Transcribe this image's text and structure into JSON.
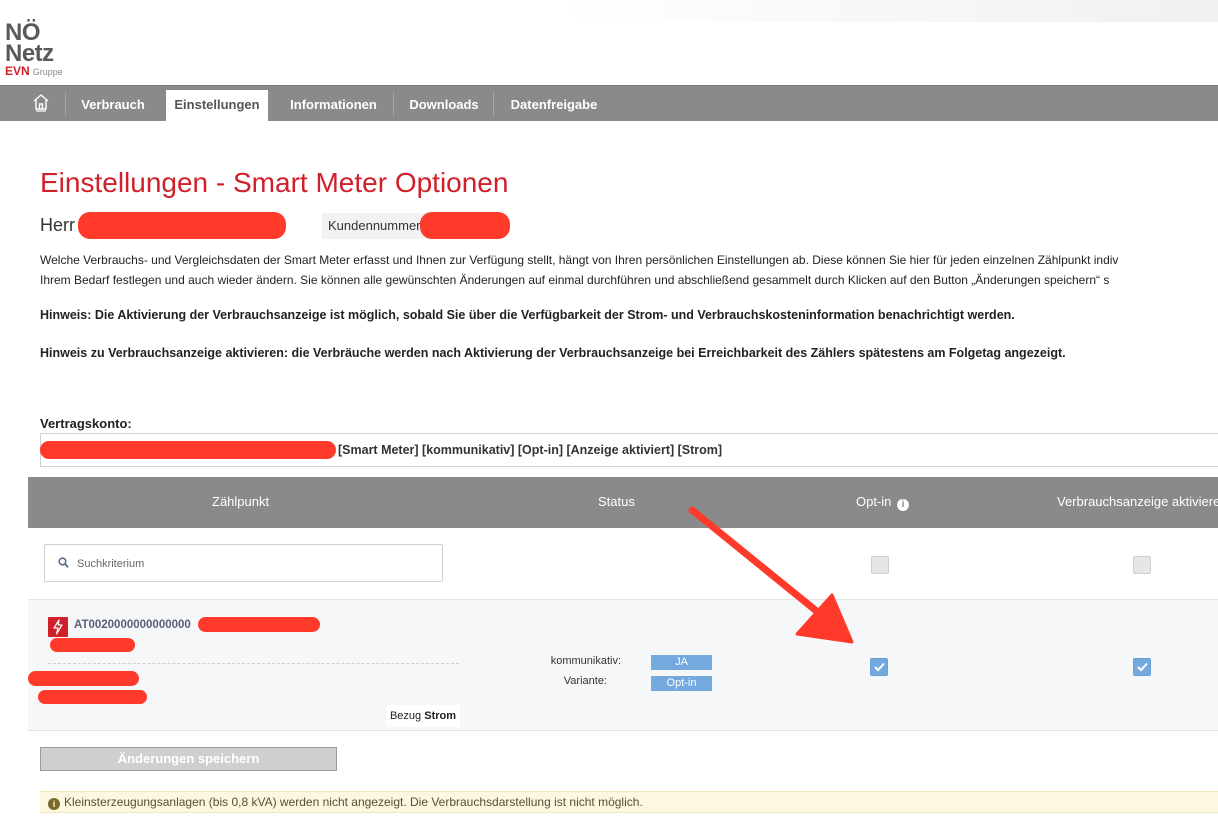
{
  "logo": {
    "line1": "NÖ",
    "line2": "Netz",
    "brand": "EVN",
    "group": "Gruppe"
  },
  "nav": {
    "home_icon": "home-icon",
    "items": [
      {
        "label": "Verbrauch"
      },
      {
        "label": "Einstellungen",
        "active": true
      },
      {
        "label": "Informationen"
      },
      {
        "label": "Downloads"
      },
      {
        "label": "Datenfreigabe"
      }
    ]
  },
  "page": {
    "title": "Einstellungen - Smart Meter Optionen",
    "salutation": "Herr",
    "customer_number_label": "Kundennummer",
    "description_line1": "Welche Verbrauchs- und Vergleichsdaten der Smart Meter erfasst und Ihnen zur Verfügung stellt, hängt von Ihren persönlichen Einstellungen ab. Diese können Sie hier für jeden einzelnen Zählpunkt indiv",
    "description_line2": "Ihrem Bedarf festlegen und auch wieder ändern. Sie können alle gewünschten Änderungen auf einmal durchführen und abschließend gesammelt durch Klicken auf den Button „Änderungen speichern“ s",
    "hint1": "Hinweis: Die Aktivierung der Verbrauchsanzeige ist möglich, sobald Sie über die Verfügbarkeit der Strom- und Verbrauchskosteninformation benachrichtigt werden.",
    "hint2": "Hinweis zu Verbrauchsanzeige aktivieren: die Verbräuche werden nach Aktivierung der Verbrauchsanzeige bei Erreichbarkeit des Zählers spätestens am Folgetag angezeigt."
  },
  "contract": {
    "label": "Vertragskonto:",
    "value": "[Smart Meter] [kommunikativ] [Opt-in] [Anzeige aktiviert] [Strom]"
  },
  "table": {
    "headers": {
      "zaehlpunkt": "Zählpunkt",
      "status": "Status",
      "optin": "Opt-in",
      "verbrauchsanzeige": "Verbrauchsanzeige aktiviere"
    },
    "search": {
      "placeholder": "Suchkriterium",
      "value": ""
    },
    "select_all": {
      "optin_checked": false,
      "verbrauchsanzeige_checked": false
    },
    "rows": [
      {
        "zaehlpunkt_id": "AT0020000000000000",
        "status_labels": {
          "kommunikativ": "kommunikativ:",
          "variante": "Variante:"
        },
        "status_values": {
          "kommunikativ": "JA",
          "variante": "Opt-in"
        },
        "bezug_label": "Bezug",
        "bezug_value": "Strom",
        "optin_checked": true,
        "verbrauchsanzeige_checked": true
      }
    ]
  },
  "actions": {
    "save_label": "Änderungen speichern"
  },
  "notice": {
    "icon": "info-icon",
    "text": "Kleinsterzeugungsanlagen (bis 0,8 kVA) werden nicht angezeigt. Die Verbrauchsdarstellung ist nicht möglich."
  },
  "colors": {
    "brand_red": "#d0202a",
    "nav_gray": "#8a8a8a",
    "badge_blue": "#74a9e0",
    "notice_bg": "#fbf7e1",
    "annotation_red": "#ff3a2a"
  }
}
